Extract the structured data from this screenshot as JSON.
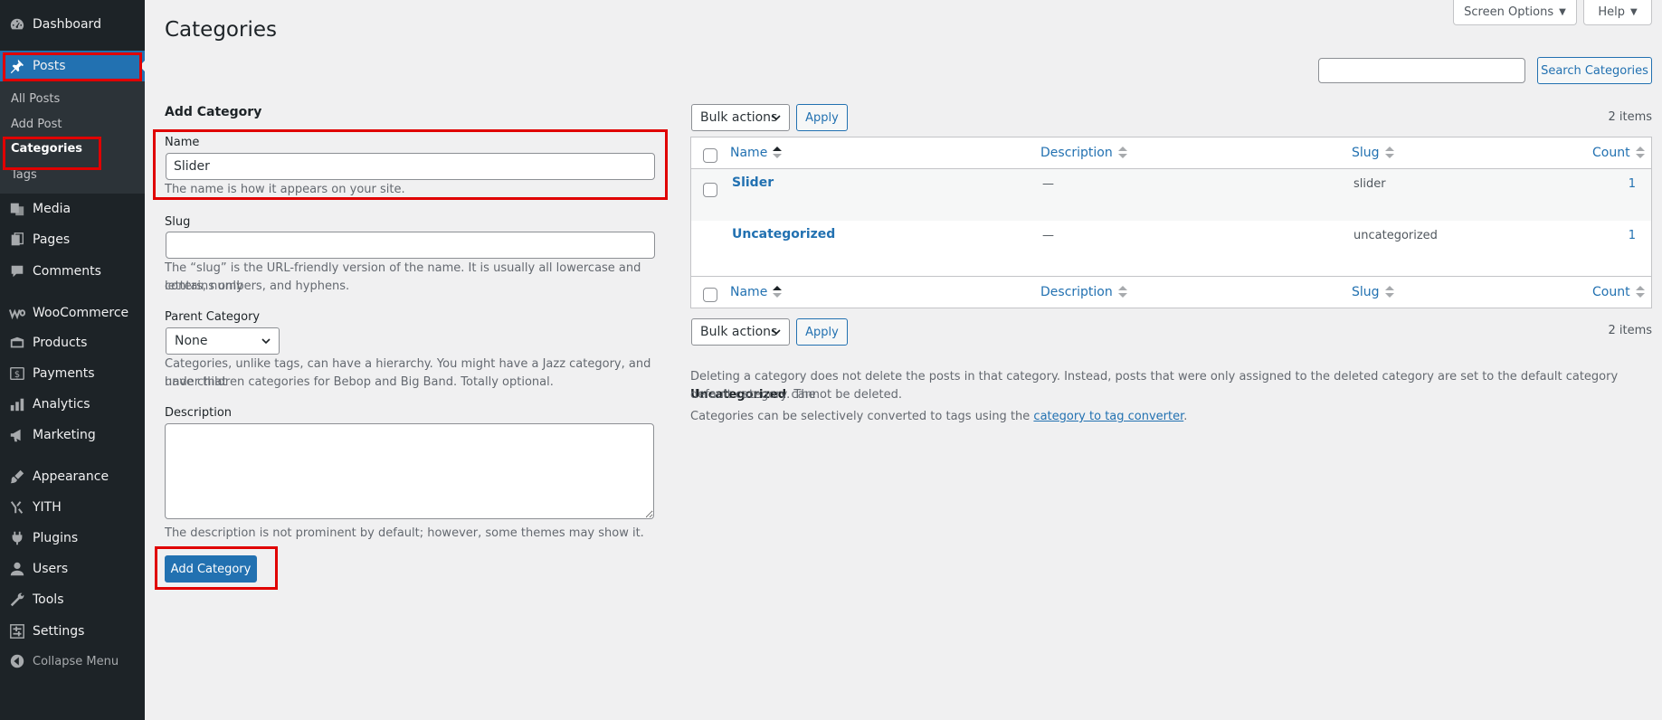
{
  "sidebar": {
    "items": [
      {
        "label": "Dashboard",
        "icon": "dashboard-icon"
      },
      {
        "label": "Posts",
        "icon": "pin-icon"
      },
      {
        "label": "Media",
        "icon": "media-icon"
      },
      {
        "label": "Pages",
        "icon": "pages-icon"
      },
      {
        "label": "Comments",
        "icon": "comments-icon"
      },
      {
        "label": "WooCommerce",
        "icon": "woocommerce-icon"
      },
      {
        "label": "Products",
        "icon": "products-icon"
      },
      {
        "label": "Payments",
        "icon": "payments-icon"
      },
      {
        "label": "Analytics",
        "icon": "analytics-icon"
      },
      {
        "label": "Marketing",
        "icon": "marketing-icon"
      },
      {
        "label": "Appearance",
        "icon": "appearance-icon"
      },
      {
        "label": "YITH",
        "icon": "yith-icon"
      },
      {
        "label": "Plugins",
        "icon": "plugins-icon"
      },
      {
        "label": "Users",
        "icon": "users-icon"
      },
      {
        "label": "Tools",
        "icon": "tools-icon"
      },
      {
        "label": "Settings",
        "icon": "settings-icon"
      }
    ],
    "submenu": [
      "All Posts",
      "Add Post",
      "Categories",
      "Tags"
    ],
    "collapse_label": "Collapse Menu"
  },
  "header": {
    "title": "Categories",
    "screen_options": "Screen Options",
    "help": "Help"
  },
  "search": {
    "value": "",
    "button": "Search Categories"
  },
  "form": {
    "heading": "Add Category",
    "name_label": "Name",
    "name_value": "Slider",
    "name_help": "The name is how it appears on your site.",
    "slug_label": "Slug",
    "slug_value": "",
    "slug_help_1": "The “slug” is the URL-friendly version of the name. It is usually all lowercase and contains only",
    "slug_help_2": "letters, numbers, and hyphens.",
    "parent_label": "Parent Category",
    "parent_value": "None",
    "parent_help_1": "Categories, unlike tags, can have a hierarchy. You might have a Jazz category, and under that",
    "parent_help_2": "have children categories for Bebop and Big Band. Totally optional.",
    "description_label": "Description",
    "description_value": "",
    "description_help": "The description is not prominent by default; however, some themes may show it.",
    "submit": "Add Category"
  },
  "table": {
    "bulk_actions": "Bulk actions",
    "apply": "Apply",
    "items_count": "2 items",
    "columns": [
      "Name",
      "Description",
      "Slug",
      "Count"
    ],
    "rows": [
      {
        "name": "Slider",
        "description": "—",
        "slug": "slider",
        "count": "1"
      },
      {
        "name": "Uncategorized",
        "description": "—",
        "slug": "uncategorized",
        "count": "1"
      }
    ]
  },
  "notes": {
    "delete_1": "Deleting a category does not delete the posts in that category. Instead, posts that were only assigned to the deleted category are set to the default category ",
    "delete_bold": "Uncategorized",
    "delete_2": ". The",
    "delete_3": "default category cannot be deleted.",
    "convert_1": "Categories can be selectively converted to tags using the ",
    "convert_link": "category to tag converter",
    "convert_2": "."
  },
  "colors": {
    "accent": "#2271b1",
    "sidebar_bg": "#1d2327",
    "highlight_box": "#e00000"
  }
}
